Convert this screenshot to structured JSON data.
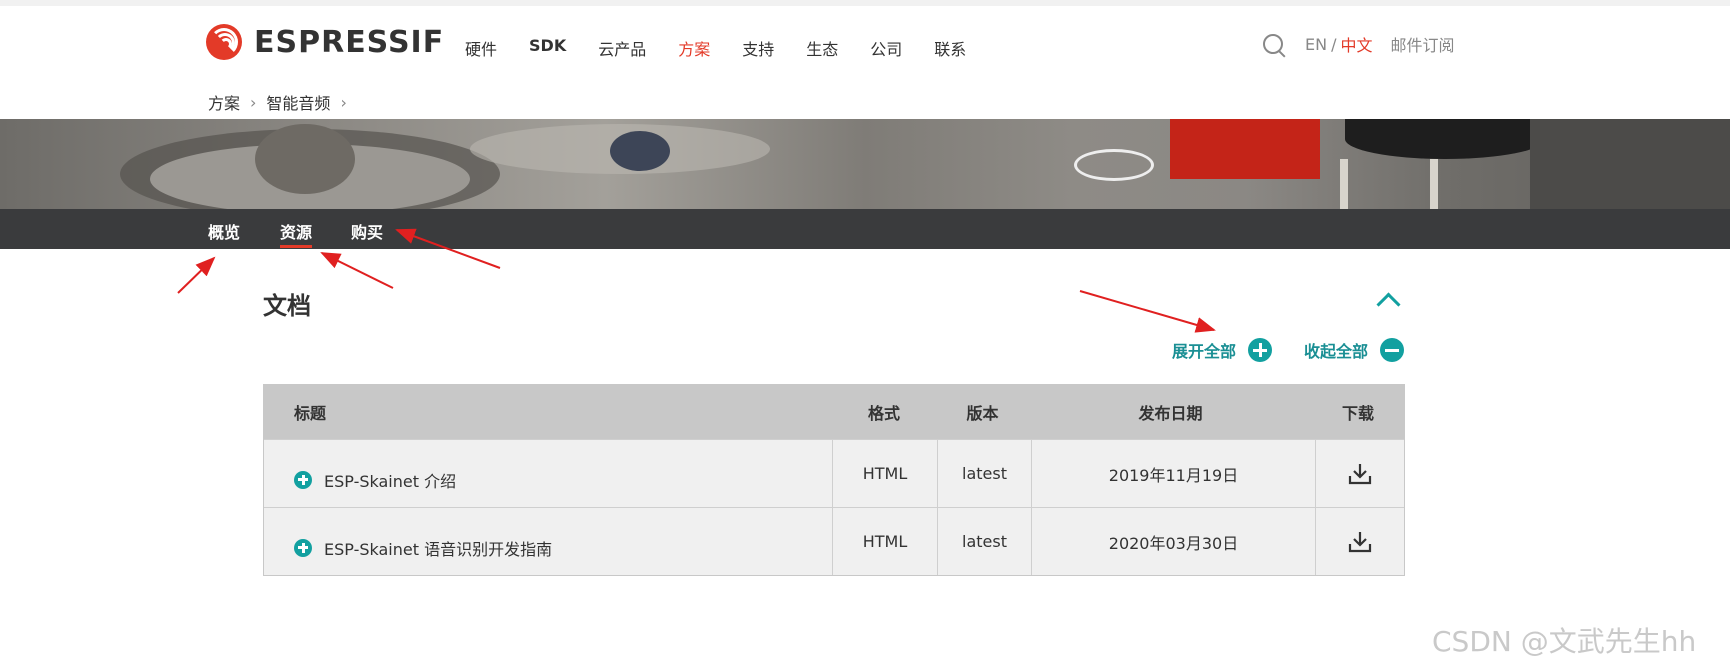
{
  "header": {
    "logo_text": "ESPRESSIF",
    "nav": [
      "硬件",
      "SDK",
      "云产品",
      "方案",
      "支持",
      "生态",
      "公司",
      "联系"
    ],
    "active_nav": "方案",
    "lang_en": "EN",
    "lang_sep": "/",
    "lang_zh": "中文",
    "subscribe": "邮件订阅",
    "search_icon": "search-icon"
  },
  "breadcrumb": [
    "方案",
    "智能音频"
  ],
  "tabs": [
    "概览",
    "资源",
    "购买"
  ],
  "active_tab": "资源",
  "section": {
    "title": "文档",
    "expand_all": "展开全部",
    "collapse_all": "收起全部"
  },
  "table": {
    "headers": [
      "标题",
      "格式",
      "版本",
      "发布日期",
      "下载"
    ],
    "rows": [
      {
        "title": "ESP-Skainet 介绍",
        "format": "HTML",
        "version": "latest",
        "date": "2019年11月19日"
      },
      {
        "title": "ESP-Skainet 语音识别开发指南",
        "format": "HTML",
        "version": "latest",
        "date": "2020年03月30日"
      }
    ]
  },
  "watermark": "CSDN @文武先生hh",
  "colors": {
    "accent_red": "#e33a28",
    "teal": "#12a0a0",
    "tabbar": "#3a3b3d"
  }
}
